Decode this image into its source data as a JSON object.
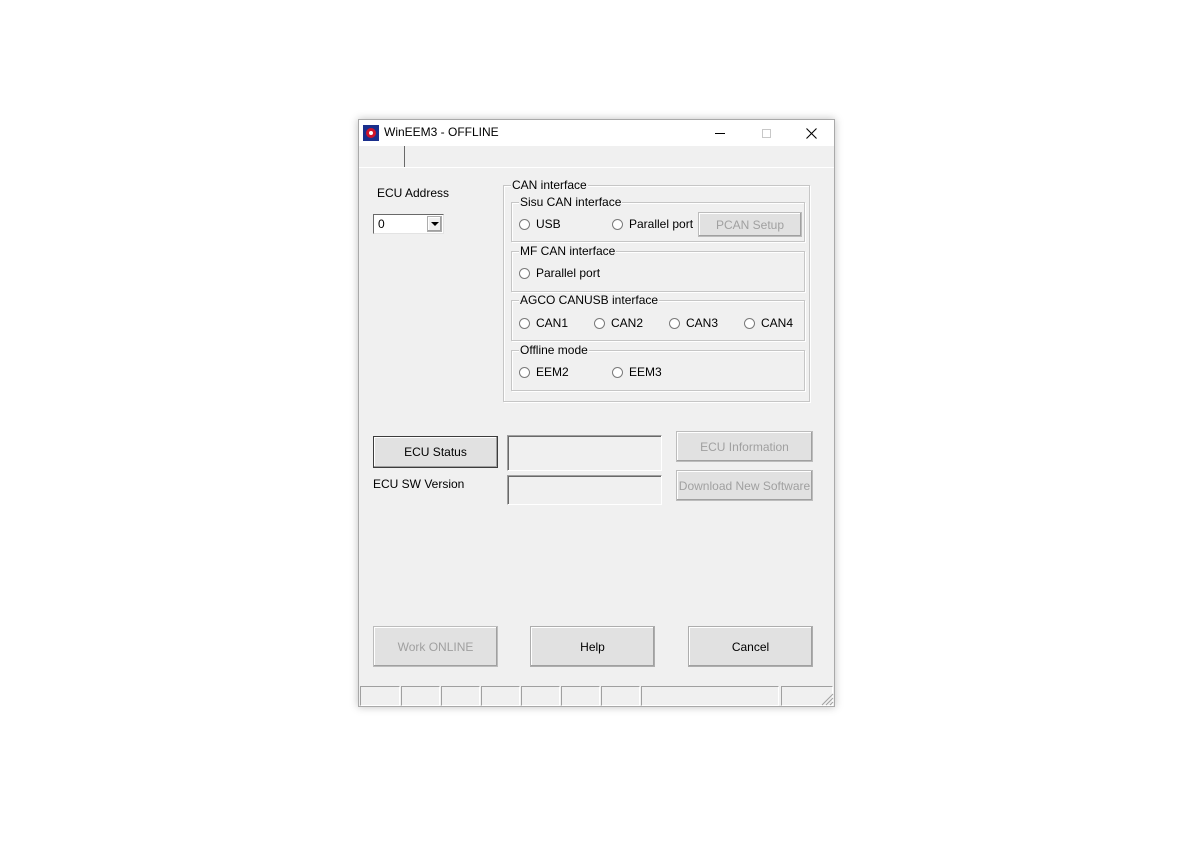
{
  "window": {
    "title": "WinEEM3 - OFFLINE"
  },
  "ecu_address": {
    "label": "ECU Address",
    "selected_value": "0"
  },
  "can_interface": {
    "title": "CAN interface",
    "sisu": {
      "title": "Sisu CAN interface",
      "options": [
        "USB",
        "Parallel port"
      ],
      "setup_button": "PCAN Setup"
    },
    "mf": {
      "title": "MF CAN interface",
      "options": [
        "Parallel port"
      ]
    },
    "agco": {
      "title": "AGCO CANUSB interface",
      "options": [
        "CAN1",
        "CAN2",
        "CAN3",
        "CAN4"
      ]
    },
    "offline": {
      "title": "Offline mode",
      "options": [
        "EEM2",
        "EEM3"
      ]
    }
  },
  "ecu": {
    "status_button": "ECU Status",
    "status_value": "",
    "sw_version_label": "ECU SW Version",
    "sw_version_value": "",
    "information_button": "ECU Information",
    "download_button": "Download New Software"
  },
  "footer": {
    "work_online": "Work ONLINE",
    "help": "Help",
    "cancel": "Cancel"
  }
}
